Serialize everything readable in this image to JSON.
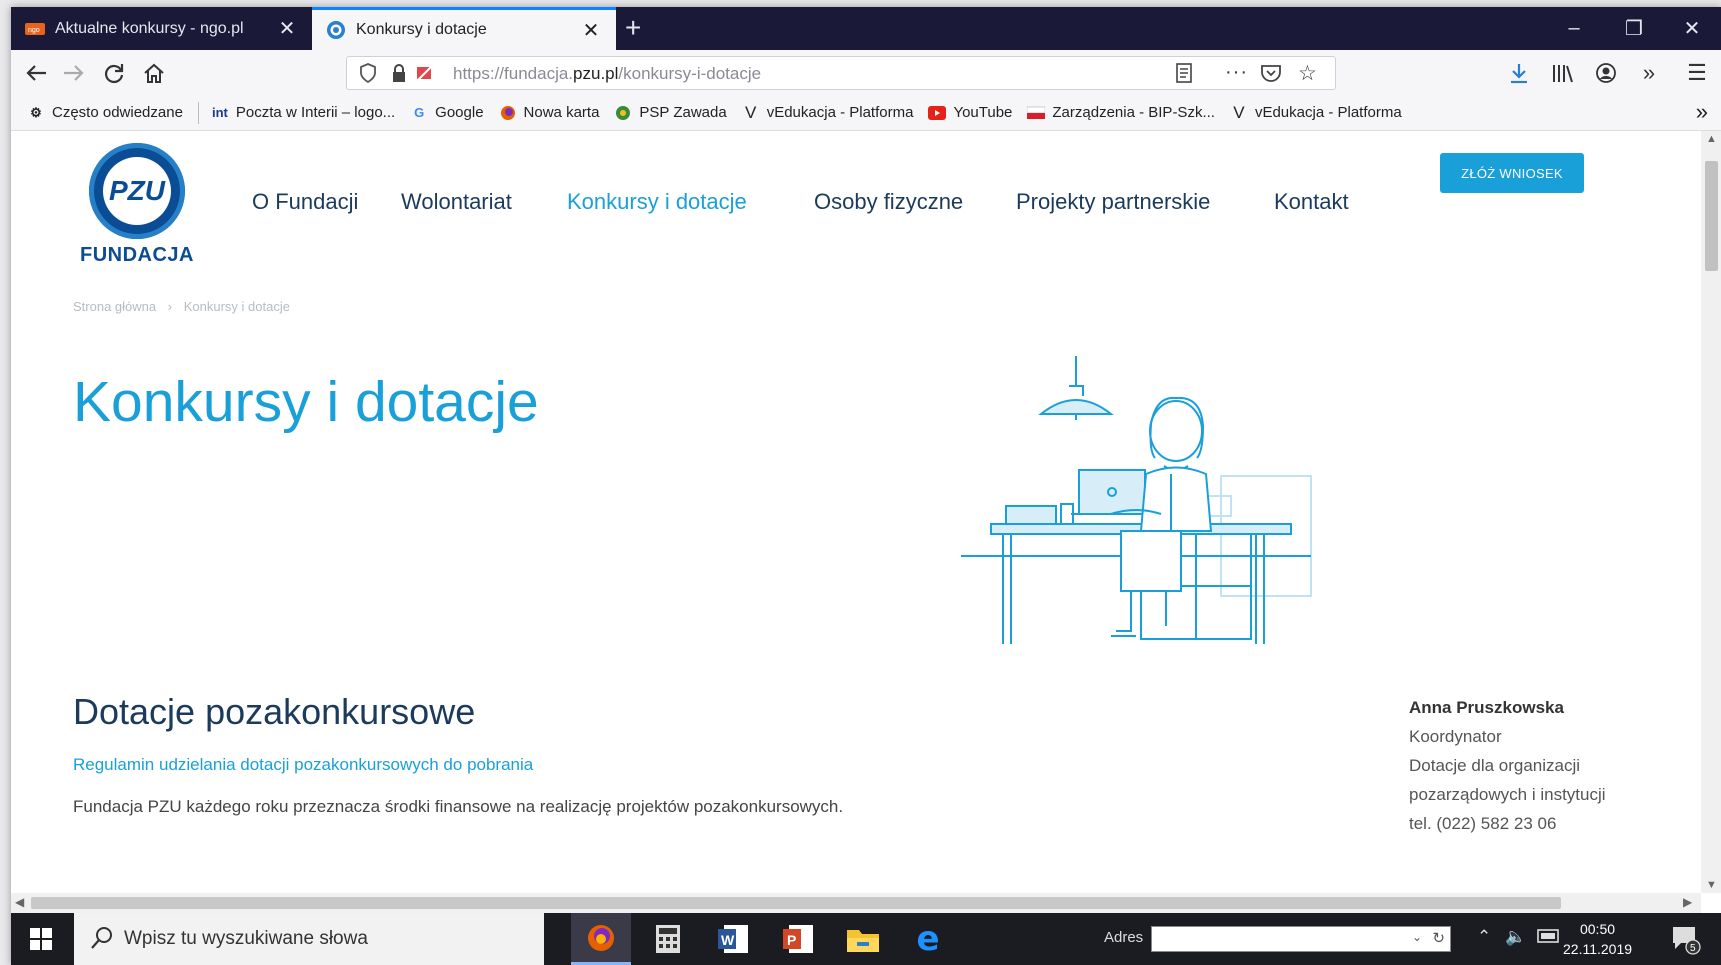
{
  "browser": {
    "tabs": [
      {
        "title": "Aktualne konkursy - ngo.pl",
        "favicon": "ngo-favicon"
      },
      {
        "title": "Konkursy i dotacje",
        "favicon": "globe-favicon"
      }
    ],
    "url_prefix": "https://fundacja.",
    "url_domain": "pzu.pl",
    "url_path": "/konkursy-i-dotacje",
    "bookmarks": [
      "Często odwiedzane",
      "Poczta w Interii – logo...",
      "Google",
      "Nowa karta",
      "PSP Zawada",
      "vEdukacja - Platforma",
      "YouTube",
      "Zarządzenia - BIP-Szk...",
      "vEdukacja - Platforma"
    ]
  },
  "site": {
    "logo_mark": "PZU",
    "logo_text": "FUNDACJA",
    "menu": [
      "O Fundacji",
      "Wolontariat",
      "Konkursy i dotacje",
      "Osoby fizyczne",
      "Projekty partnerskie",
      "Kontakt"
    ],
    "active_menu": "Konkursy i dotacje",
    "cta": "ZŁÓŻ WNIOSEK",
    "breadcrumb_home": "Strona główna",
    "breadcrumb_sep": "›",
    "breadcrumb_current": "Konkursy i dotacje",
    "title": "Konkursy i dotacje",
    "section_title": "Dotacje pozakonkursowe",
    "section_link": "Regulamin udzielania dotacji pozakonkursowych do pobrania",
    "section_text": "Fundacja PZU każdego roku przeznacza środki finansowe na realizację projektów pozakonkursowych.",
    "contact": {
      "name": "Anna Pruszkowska",
      "role": "Koordynator",
      "line1": "Dotacje dla organizacji",
      "line2": "pozarządowych i instytucji",
      "phone": "tel. (022) 582 23 06"
    }
  },
  "taskbar": {
    "search_placeholder": "Wpisz tu wyszukiwane słowa",
    "address_label": "Adres",
    "time": "00:50",
    "date": "22.11.2019",
    "notification_count": "5"
  },
  "colors": {
    "accent": "#1aa0d8",
    "navy": "#1b3a5c",
    "logo_blue": "#0a4d95",
    "tabbar": "#1a1a38"
  }
}
